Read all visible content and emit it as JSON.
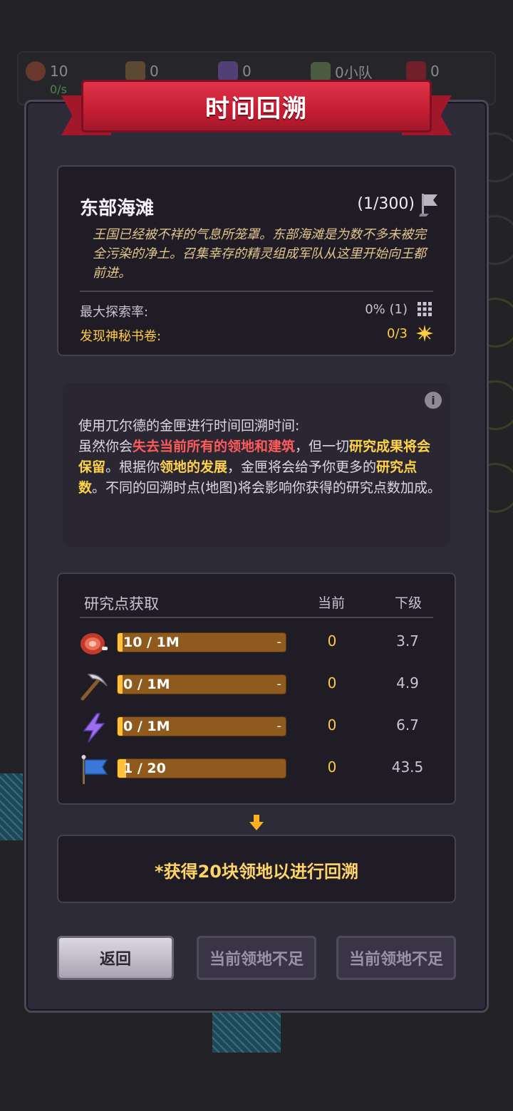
{
  "resources": [
    {
      "value": "10",
      "rate": "0/s",
      "icon": "meat-icon",
      "color": "#a04a30"
    },
    {
      "value": "0",
      "icon": "pickaxe-icon",
      "color": "#8a6a40"
    },
    {
      "value": "0",
      "icon": "lightning-icon",
      "color": "#7a5ab8"
    },
    {
      "value": "0小队",
      "icon": "sword-icon",
      "color": "#6a8a5a"
    },
    {
      "value": "0",
      "icon": "banner-icon",
      "color": "#b02030"
    }
  ],
  "dialog": {
    "title": "时间回溯"
  },
  "region": {
    "name": "东部海滩",
    "count": "(1/300)",
    "description": "王国已经被不祥的气息所笼罩。东部海滩是为数不多未被完全污染的净土。召集幸存的精灵组成军队从这里开始向王都前进。",
    "max_explore_label": "最大探索率:",
    "max_explore_value": "0% (1)",
    "tomes_label": "发现神秘书卷:",
    "tomes_value": "0/3"
  },
  "info": {
    "line1": "使用兀尔德的金匣进行时间回溯时间:",
    "p1": "虽然你会",
    "p2": "失去当前所有的领地和建筑",
    "p3": "，但一切",
    "p4": "研究成果将会保留",
    "p5": "。根据你",
    "p6": "领地的发展",
    "p7": "，金匣将会给予你更多的",
    "p8": "研究点数",
    "p9": "。不同的回溯时点(地图)将会影响你获得的研究点数加成。"
  },
  "research": {
    "header": "研究点获取",
    "col_current": "当前",
    "col_next": "下级",
    "rows": [
      {
        "icon": "meat-icon",
        "bar_text": "10 / 1M",
        "fill": 0.03,
        "dash": "-",
        "current": "0",
        "next": "3.7"
      },
      {
        "icon": "pickaxe-icon",
        "bar_text": "0 / 1M",
        "fill": 0.03,
        "dash": "-",
        "current": "0",
        "next": "4.9"
      },
      {
        "icon": "lightning-icon",
        "bar_text": "0 / 1M",
        "fill": 0.03,
        "dash": "-",
        "current": "0",
        "next": "6.7"
      },
      {
        "icon": "flag-icon",
        "bar_text": "1 / 20",
        "fill": 0.05,
        "dash": "",
        "current": "0",
        "next": "43.5"
      }
    ]
  },
  "requirement": "*获得20块领地以进行回溯",
  "buttons": {
    "back": "返回",
    "insufficient_1": "当前领地不足",
    "insufficient_2": "当前领地不足"
  },
  "colors": {
    "accent_yellow": "#ffcc44",
    "accent_red": "#ff5a5a",
    "ribbon": "#c41d33",
    "panel": "#2e2b38"
  }
}
